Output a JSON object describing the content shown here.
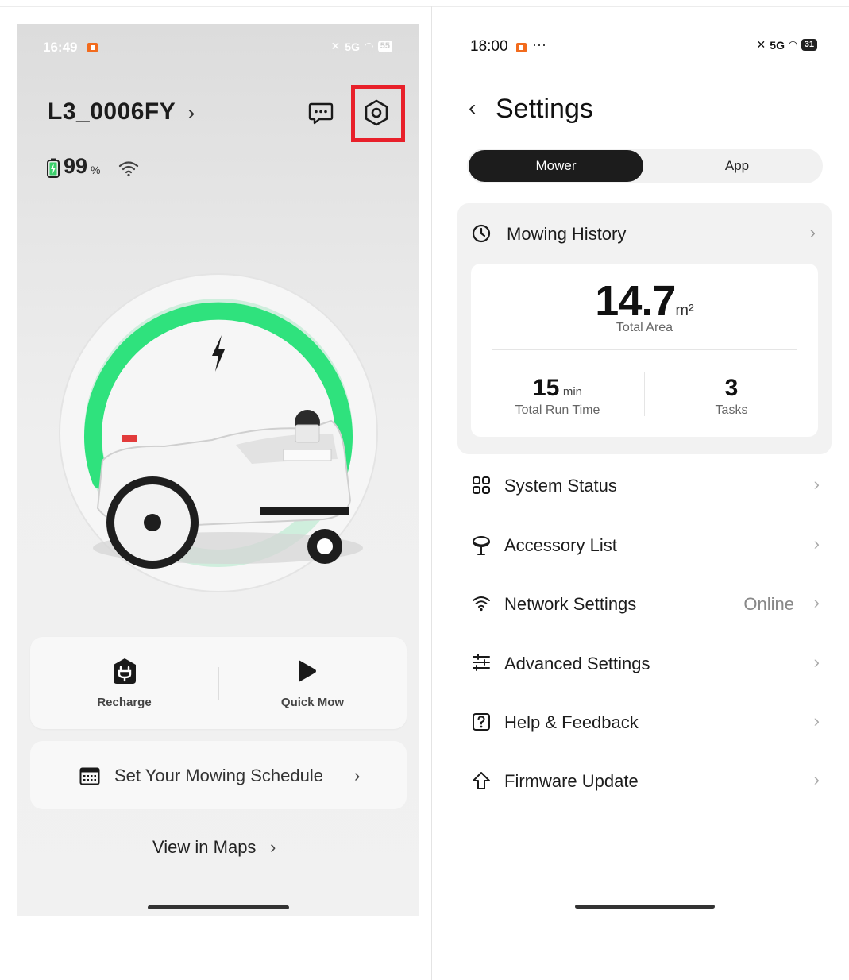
{
  "left_screen": {
    "status_bar": {
      "time": "16:49",
      "signal": "5G",
      "battery": "55"
    },
    "device_name": "L3_0006FY",
    "battery_percent": "99",
    "battery_unit": "%",
    "actions": [
      {
        "label": "Recharge",
        "icon": "charger-plug-icon"
      },
      {
        "label": "Quick Mow",
        "icon": "play-icon"
      }
    ],
    "schedule_label": "Set Your Mowing Schedule",
    "view_maps_label": "View in Maps",
    "highlight_color": "#e8202a",
    "ring_color": "#2fe27d"
  },
  "right_screen": {
    "status_bar": {
      "time": "18:00",
      "dots": "···",
      "signal": "5G",
      "battery": "31"
    },
    "title": "Settings",
    "tabs": [
      {
        "label": "Mower",
        "active": true
      },
      {
        "label": "App",
        "active": false
      }
    ],
    "mowing_history": {
      "title": "Mowing History",
      "total_area_value": "14.7",
      "total_area_unit": "m²",
      "total_area_label": "Total Area",
      "run_time_value": "15",
      "run_time_unit": "min",
      "run_time_label": "Total Run Time",
      "tasks_value": "3",
      "tasks_label": "Tasks"
    },
    "menu": [
      {
        "label": "System Status",
        "icon": "grid-icon",
        "value": ""
      },
      {
        "label": "Accessory List",
        "icon": "accessory-icon",
        "value": ""
      },
      {
        "label": "Network Settings",
        "icon": "wifi-icon",
        "value": "Online"
      },
      {
        "label": "Advanced Settings",
        "icon": "sliders-icon",
        "value": ""
      },
      {
        "label": "Help & Feedback",
        "icon": "help-icon",
        "value": ""
      },
      {
        "label": "Firmware Update",
        "icon": "upload-arrow-icon",
        "value": ""
      }
    ]
  }
}
